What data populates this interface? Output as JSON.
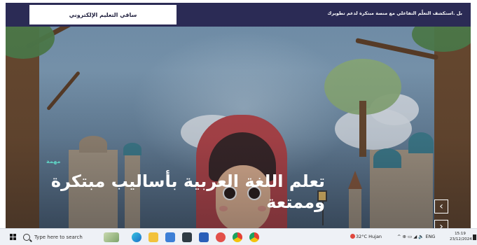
{
  "header": {
    "logo_text": "ساقي التعليم الإلكتروني",
    "ticker_text": "بل .استكشف التعلّم التفاعلي مع منصة مبتكرة لدعم تطويرك"
  },
  "hero": {
    "tag": "مهمة",
    "headline": "تعلم اللغة العربية بأساليب مبتكرة وممتعة"
  },
  "slider": {
    "prev_symbol": "‹",
    "next_symbol": "›"
  },
  "taskbar": {
    "search_placeholder": "Type here to search",
    "weather": "32°C  Hujan",
    "tray": "^  ⊕  ▭  ◢  🔈  ENG",
    "time": "15:19",
    "date": "23/12/2024"
  }
}
